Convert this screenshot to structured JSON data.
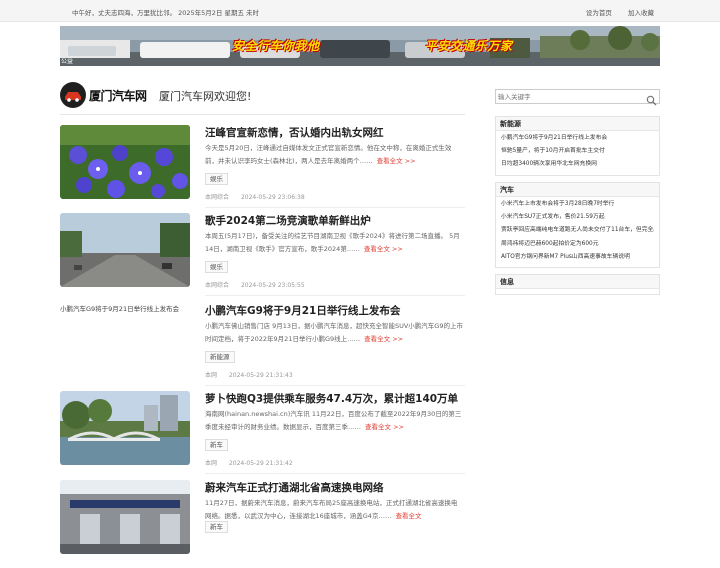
{
  "topbar": {
    "greeting": "中午好，丈夫志四海，万里犹比邻。 2025年5月2日 星期五 未时",
    "links": [
      "设为首页",
      "加入收藏"
    ]
  },
  "banner": {
    "slogan_left": "安全行车你我他",
    "slogan_right": "平安交通乐万家",
    "corner_label": "公益"
  },
  "header": {
    "logo_text": "厦门汽车网",
    "welcome": "厦门汽车网欢迎您!"
  },
  "articles": [
    {
      "title": "汪峰官宣新恋情，否认婚内出轨女网红",
      "excerpt": "今天是5月20日，汪峰通过自媒体发文正式官宣新恋情。他在文中称，在离婚正式生效前，并未认识李玙女士(森林北)，两人是去年离婚两个……",
      "more": "查看全文 >>",
      "tag": "娱乐",
      "source": "本网综合",
      "time": "2024-05-29 23:06:38"
    },
    {
      "title": "歌手2024第二场竞演歌单新鲜出炉",
      "excerpt": "本周五(5月17日)，备受关注的综艺节目湖南卫视《歌手2024》将进行第二场直播。 5月14日，湖南卫视《歌手》官方宣布，歌手2024第……",
      "more": "查看全文 >>",
      "tag": "娱乐",
      "source": "本网综合",
      "time": "2024-05-29 23:05:55"
    },
    {
      "alt": "小鹏汽车G9将于9月21日举行线上发布会",
      "title": "小鹏汽车G9将于9月21日举行线上发布会",
      "excerpt": "小鹏汽车佛山销售门店 9月13日，据小鹏汽车消息，超快充全智能SUV小鹏汽车G9的上市时间定档，将于2022年9月21日举行小鹏G9线上……",
      "more": "查看全文 >>",
      "tag": "新能源",
      "source": "本网",
      "time": "2024-05-29 21:31:43"
    },
    {
      "title": "萝卜快跑Q3提供乘车服务47.4万次，累计超140万单",
      "excerpt": "海南网(hainan.newshai.cn)汽车讯 11月22日，百度公布了截至2022年9月30日的第三季度未经审计的财务业绩。数据显示，百度第三季……",
      "more": "查看全文 >>",
      "tag": "新车",
      "source": "本网",
      "time": "2024-05-29 21:31:42"
    },
    {
      "title": "蔚来汽车正式打通湖北省高速换电网络",
      "excerpt": "11月27日，据蔚来汽车消息，蔚来汽车布局25座高速换电站，正式打通湖北省高速换电网络。据悉，以武汉为中心，连接湖北16座城市，涵盖G4京……",
      "more": "查看全文",
      "tag": "新车",
      "source": "",
      "time": ""
    }
  ],
  "sidebar": {
    "search_placeholder": "输入关键字",
    "widgets": [
      {
        "title": "新能源",
        "items": [
          "小鹏汽车G9将于9月21日举行线上发布会",
          "恒驰5量产，将于10月开启首批车主交付",
          "日均超3400辆次享用华北车网充换网"
        ]
      },
      {
        "title": "汽车",
        "items": [
          "小米汽车上市发布会将于3月28日晚7时举行",
          "小米汽车SU7正式发布，售价21.59万起",
          "贾跃亭回应高端纯电车道跑无人尚未交付了11台车，但完全原创",
          "周鸿祎将迈巴赫600起拍价定为600元",
          "AITO官方钢问界新M7 Plus山西高速事故车辆说明"
        ]
      },
      {
        "title": "信息",
        "items": []
      }
    ]
  },
  "colors": {
    "accent_red": "#e03c31",
    "slogan_yellow": "#ffe000",
    "slogan_outline": "#c00000"
  }
}
